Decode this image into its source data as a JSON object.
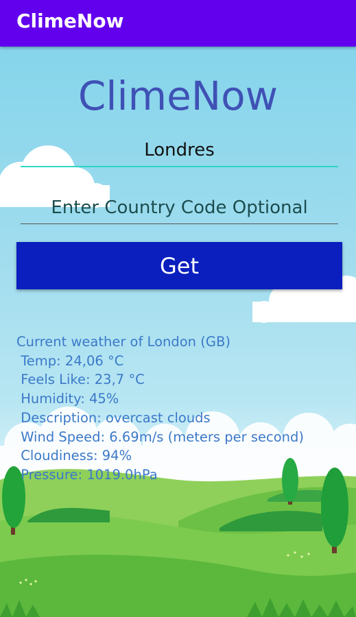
{
  "app_bar": {
    "title": "ClimeNow"
  },
  "header": {
    "title": "ClimeNow"
  },
  "city_input": {
    "value": "Londres"
  },
  "country_input": {
    "placeholder": "Enter Country Code Optional"
  },
  "get_button": {
    "label": "Get"
  },
  "weather": {
    "heading": "Current weather of London (GB)",
    "temp": " Temp: 24,06 °C",
    "feels_like": " Feels Like: 23,7 °C",
    "humidity": " Humidity: 45%",
    "description": " Description: overcast clouds",
    "wind_speed": " Wind Speed: 6.69m/s (meters per second)",
    "cloudiness": " Cloudiness: 94%",
    "pressure": " Pressure: 1019.0hPa"
  },
  "colors": {
    "app_bar": "#6200ee",
    "title": "#3f51b5",
    "button": "#0a1fbe",
    "accent": "#2fd6c4",
    "weather_text": "#3b79c8"
  }
}
